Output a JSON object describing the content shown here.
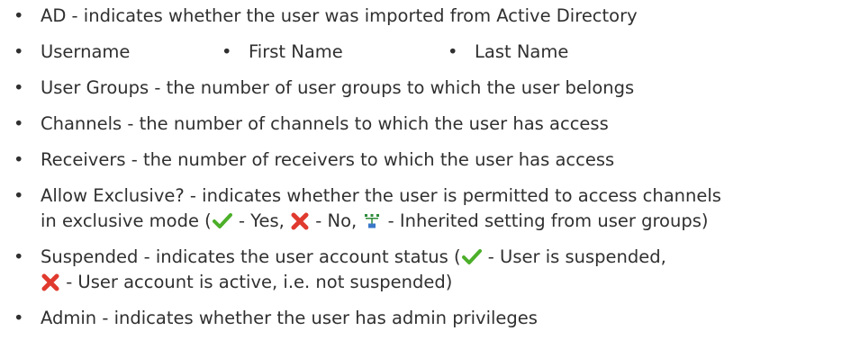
{
  "bullet_glyph": "•",
  "items": {
    "ad": "AD - indicates whether the user was imported from Active Directory",
    "username": "Username",
    "first_name": "First Name",
    "last_name": "Last Name",
    "user_groups": "User Groups - the number of user groups to which the user belongs",
    "channels": "Channels - the number of channels to which the user has access",
    "receivers": "Receivers - the number of receivers to which the user has access",
    "allow_exclusive_line1": "Allow Exclusive? - indicates whether the user is permitted to access channels",
    "allow_exclusive_line2_a": "in exclusive mode (",
    "allow_exclusive_line2_b": " - Yes, ",
    "allow_exclusive_line2_c": " - No, ",
    "allow_exclusive_line2_d": " - Inherited setting from user groups)",
    "suspended_line1_a": "Suspended - indicates the user account status (",
    "suspended_line1_b": " - User is suspended,",
    "suspended_line2": " - User account is active, i.e. not suspended)",
    "admin": "Admin - indicates whether the user has admin privileges"
  },
  "icons": {
    "check": "green-checkmark-icon",
    "cross": "red-x-icon",
    "inherited": "group-tree-icon"
  },
  "colors": {
    "text": "#303030",
    "check": "#4caf2a",
    "cross": "#e03a2e",
    "inherited_top": "#2e8b3a",
    "inherited_bottom": "#3a78c8"
  }
}
